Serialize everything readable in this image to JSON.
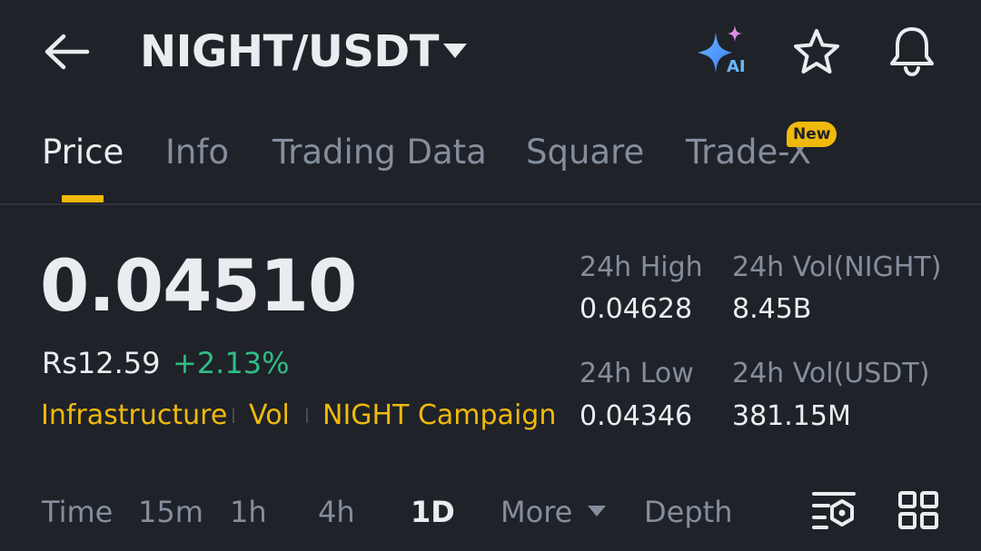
{
  "header": {
    "pair": "NIGHT/USDT",
    "icons": [
      "back-arrow-icon",
      "caret-down-icon",
      "ai-sparkle-icon",
      "star-icon",
      "bell-icon"
    ],
    "ai_label": "AI"
  },
  "tabs": [
    {
      "label": "Price",
      "active": true
    },
    {
      "label": "Info",
      "active": false
    },
    {
      "label": "Trading Data",
      "active": false
    },
    {
      "label": "Square",
      "active": false
    },
    {
      "label": "Trade-X",
      "active": false,
      "badge": "New"
    }
  ],
  "price": {
    "last": "0.04510",
    "fiat": "Rs12.59",
    "change": "+2.13%"
  },
  "tags": [
    "Infrastructure",
    "Vol",
    "NIGHT Campaign"
  ],
  "stats": {
    "high_label": "24h High",
    "high_value": "0.04628",
    "low_label": "24h Low",
    "low_value": "0.04346",
    "vol_base_label": "24h Vol(NIGHT)",
    "vol_base_value": "8.45B",
    "vol_quote_label": "24h Vol(USDT)",
    "vol_quote_value": "381.15M"
  },
  "intervals": {
    "time": "Time",
    "items": [
      "15m",
      "1h",
      "4h",
      "1D"
    ],
    "active": "1D",
    "more": "More",
    "depth": "Depth"
  },
  "colors": {
    "background": "#1f2229",
    "accent": "#f0b90b",
    "up": "#2ebd85",
    "text_primary": "#eaecef",
    "text_secondary": "#848e9c"
  }
}
